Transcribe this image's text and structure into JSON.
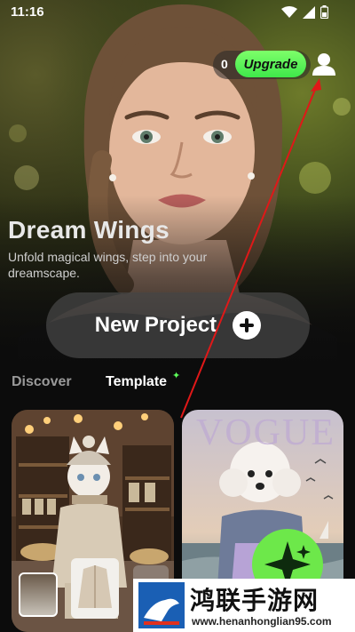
{
  "status_bar": {
    "time": "11:16",
    "icons": [
      "wifi-icon",
      "signal-icon",
      "battery-icon"
    ]
  },
  "header": {
    "credits": "0",
    "upgrade_label": "Upgrade",
    "profile_icon": "user-icon"
  },
  "hero": {
    "title": "Dream Wings",
    "subtitle": "Unfold magical wings, step into your dreamscape."
  },
  "new_project": {
    "label": "New Project",
    "icon": "plus-circle-icon"
  },
  "tabs": [
    {
      "label": "Discover",
      "active": false
    },
    {
      "label": "Template",
      "active": true,
      "badge_icon": "sparkle-icon"
    }
  ],
  "cards": [
    {
      "name": "cat-in-knit-outfit-template"
    },
    {
      "name": "poodle-vogue-template",
      "magazine_text": "VOGUE"
    }
  ],
  "watermark": {
    "title": "鸿联手游网",
    "url": "www.henanhonglian95.com"
  },
  "colors": {
    "accent_green": "#4cec4c",
    "background": "#0c0c0c"
  }
}
